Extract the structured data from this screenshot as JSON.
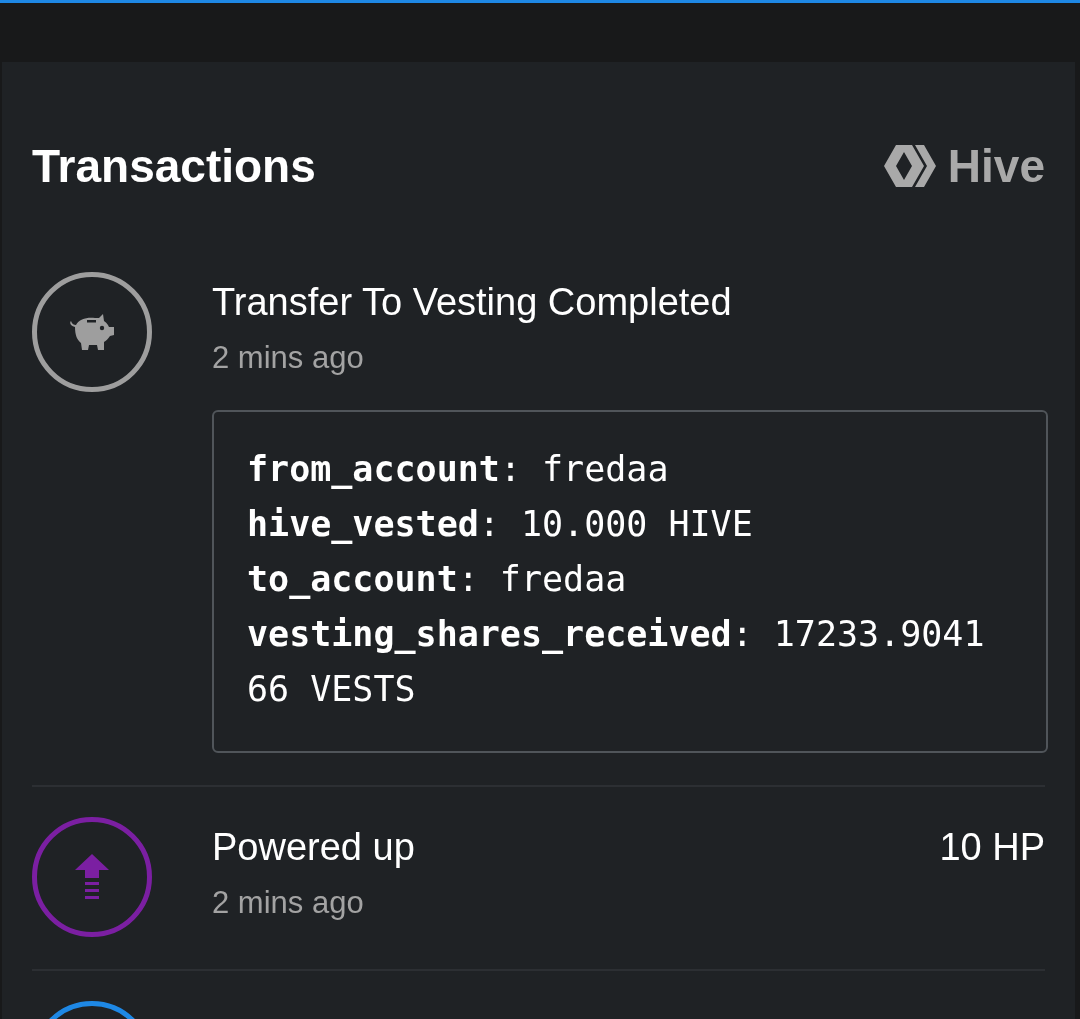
{
  "header": {
    "title": "Transactions",
    "brand": "Hive"
  },
  "transactions": [
    {
      "kind": "piggy",
      "color": "#9e9e9e",
      "title": "Transfer To Vesting Completed",
      "time": "2 mins ago",
      "details": [
        "**from_account**: fredaa",
        "**hive_vested**: 10.000 HIVE",
        "**to_account**: fredaa",
        "**vesting_shares_received**: 17233.904166 VESTS"
      ]
    },
    {
      "kind": "power_up",
      "color": "#7b1fa2",
      "title": "Powered up",
      "time": "2 mins ago",
      "amount": "10 HP"
    },
    {
      "kind": "cut_off",
      "color": "#1e88e5"
    }
  ]
}
